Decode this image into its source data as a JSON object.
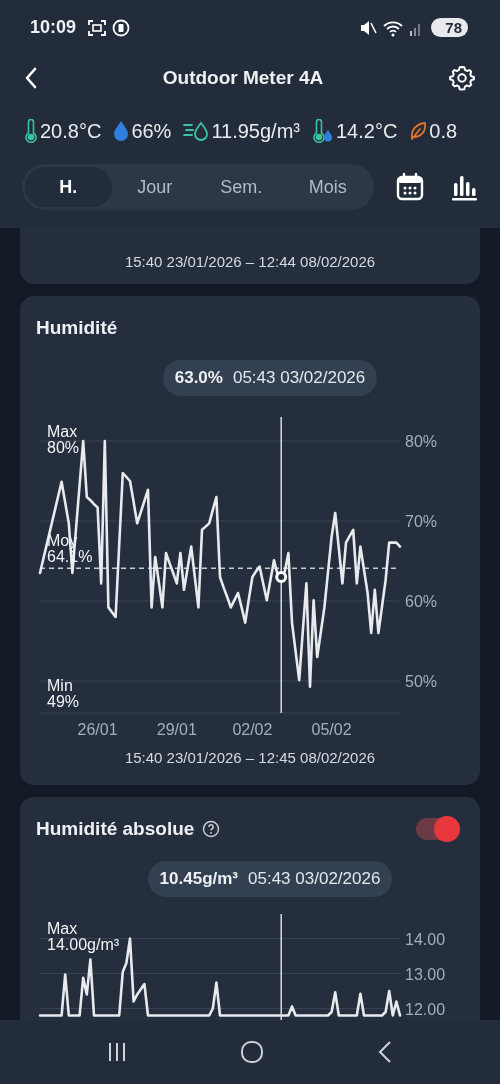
{
  "status_bar": {
    "time": "10:09",
    "battery": "78"
  },
  "header": {
    "title": "Outdoor Meter 4A"
  },
  "readings": [
    {
      "kind": "temperature",
      "color": "#3cc4a0",
      "value": "20.8°C"
    },
    {
      "kind": "humidity",
      "color": "#2f7fe0",
      "value": "66%"
    },
    {
      "kind": "absolute_humidity",
      "color": "#3cc4a0",
      "value": "11.95g/m³"
    },
    {
      "kind": "dew_point",
      "color": "#3cc4a0",
      "value": "14.2°C"
    },
    {
      "kind": "vpd",
      "color": "#e0762f",
      "value": "0.8"
    }
  ],
  "period_tabs": [
    {
      "label": "H.",
      "selected": true
    },
    {
      "label": "Jour",
      "selected": false
    },
    {
      "label": "Sem.",
      "selected": false
    },
    {
      "label": "Mois",
      "selected": false
    }
  ],
  "cards": [
    {
      "kind": "partial",
      "range": "15:40 23/01/2026 – 12:44 08/02/2026"
    },
    {
      "kind": "chart",
      "title": "Humidité",
      "tooltip": {
        "value": "63.0%",
        "time": "05:43 03/02/2026"
      },
      "stats": [
        {
          "kind": "max",
          "label": "Max",
          "value": "80%"
        },
        {
          "kind": "avg",
          "label": "Moy",
          "value": "64.1%"
        },
        {
          "kind": "min",
          "label": "Min",
          "value": "49%"
        }
      ],
      "chart_data": {
        "type": "line",
        "grid": true,
        "ylim": [
          46,
          83
        ],
        "yticks": [
          {
            "value": 80,
            "label": "80%"
          },
          {
            "value": 70,
            "label": "70%"
          },
          {
            "value": 60,
            "label": "60%"
          },
          {
            "value": 50,
            "label": "50%"
          }
        ],
        "categories": [
          null,
          null,
          null,
          null,
          null,
          null,
          null,
          null,
          null,
          null,
          null,
          null,
          null,
          null,
          null,
          null,
          "26/01",
          null,
          null,
          null,
          null,
          null,
          null,
          null,
          null,
          null,
          null,
          null,
          null,
          null,
          null,
          null,
          null,
          null,
          null,
          null,
          null,
          null,
          "29/01",
          null,
          null,
          null,
          null,
          null,
          null,
          null,
          null,
          null,
          null,
          null,
          null,
          null,
          null,
          null,
          null,
          null,
          null,
          null,
          null,
          "02/02",
          null,
          null,
          null,
          null,
          null,
          null,
          null,
          null,
          null,
          null,
          null,
          null,
          null,
          null,
          null,
          null,
          null,
          null,
          null,
          null,
          null,
          "05/02",
          null,
          null,
          null,
          null,
          null,
          null,
          null,
          null,
          null,
          null,
          null,
          null,
          null,
          null,
          null,
          null,
          null,
          null,
          null
        ],
        "series": [
          {
            "color": "#e8eaed",
            "values": [
              63.5,
              65.4,
              67.3,
              69.2,
              71.1,
              73.0,
              74.9,
              72.3,
              69.7,
              63.5,
              69.0,
              74.5,
              80,
              73,
              72.6,
              72.1,
              71.7,
              62.2,
              80,
              59.2,
              58.6,
              58,
              67,
              76,
              75.5,
              75,
              72.4,
              69.7,
              71.1,
              72.5,
              73.9,
              59.2,
              65.5,
              62.4,
              59.2,
              66,
              64.7,
              63.5,
              62.2,
              66,
              61.4,
              64.1,
              66.8,
              63,
              59.2,
              68.9,
              69.3,
              69.7,
              71.4,
              73,
              63,
              61.7,
              60.5,
              59.2,
              60.1,
              61,
              59.2,
              57.3,
              60.2,
              63,
              63.7,
              64.3,
              62.2,
              60.1,
              62.6,
              65.1,
              63.3,
              63.0,
              63.7,
              66,
              57.3,
              53.7,
              50.1,
              56.2,
              62.2,
              49.3,
              60.1,
              53,
              56.1,
              59.2,
              63.6,
              68,
              71,
              66.6,
              62.2,
              67.3,
              68.1,
              68.9,
              62.2,
              66.8,
              63.9,
              61,
              56,
              61.4,
              56,
              59.3,
              62.6,
              67.3,
              67.3,
              67.3,
              66.8
            ]
          }
        ],
        "ref_lines": [
          {
            "axis": "y",
            "value": 64.1
          }
        ]
      },
      "range": "15:40 23/01/2026 – 12:45 08/02/2026"
    },
    {
      "kind": "chart",
      "title": "Humidité absolue",
      "help": true,
      "toggle": {
        "on": true
      },
      "tooltip": {
        "value": "10.45g/m³",
        "time": "05:43 03/02/2026"
      },
      "stats": [
        {
          "kind": "max",
          "label": "Max",
          "value": "14.00g/m³"
        }
      ],
      "chart_data": {
        "type": "line",
        "grid": true,
        "ylim": [
          11,
          14.7
        ],
        "yticks": [
          {
            "value": 14,
            "label": "14.00"
          },
          {
            "value": 13,
            "label": "13.00"
          },
          {
            "value": 12,
            "label": "12.00"
          }
        ],
        "categories": [
          null,
          null,
          null,
          null,
          null,
          null,
          null,
          null,
          null,
          null,
          null,
          null,
          null,
          null,
          null,
          null,
          null,
          null,
          null,
          null,
          null,
          null,
          null,
          null,
          null,
          null,
          null,
          null,
          null,
          null,
          null,
          null,
          null,
          null,
          null,
          null,
          null,
          null,
          null,
          null,
          null,
          null,
          null,
          null,
          null,
          null,
          null,
          null,
          null,
          null,
          null,
          null,
          null,
          null,
          null,
          null,
          null,
          null,
          null,
          null,
          null,
          null,
          null,
          null,
          null,
          null,
          null,
          null,
          null,
          null,
          null,
          null,
          null,
          null,
          null,
          null,
          null,
          null,
          null,
          null,
          null,
          null,
          null,
          null,
          null,
          null,
          null,
          null,
          null,
          null,
          null,
          null,
          null,
          null,
          null,
          null,
          null,
          null,
          null,
          null,
          null
        ],
        "series": [
          {
            "color": "#e8eaed",
            "values": [
              11.8,
              11.8,
              11.8,
              11.8,
              11.8,
              11.8,
              11.8,
              12.97,
              11.8,
              11.8,
              11.8,
              11.8,
              12.88,
              12.4,
              13.4,
              11.8,
              11.8,
              11.8,
              11.8,
              11.8,
              11.8,
              11.8,
              11.8,
              13.05,
              13.3,
              14.0,
              12.2,
              12.4,
              12.55,
              12.7,
              11.8,
              11.8,
              11.8,
              11.8,
              11.8,
              11.8,
              11.8,
              11.8,
              11.8,
              11.8,
              11.8,
              11.8,
              11.8,
              11.8,
              11.8,
              11.8,
              11.8,
              11.8,
              12.0,
              12.74,
              11.8,
              11.8,
              11.8,
              11.8,
              11.8,
              11.8,
              11.8,
              11.8,
              11.8,
              11.8,
              11.8,
              11.8,
              11.8,
              11.8,
              11.8,
              11.8,
              11.8,
              11.8,
              11.8,
              11.8,
              12.06,
              11.8,
              11.8,
              11.8,
              11.8,
              11.8,
              11.8,
              11.8,
              11.8,
              11.8,
              11.8,
              11.9,
              12.46,
              11.8,
              11.8,
              11.8,
              11.8,
              11.8,
              11.8,
              12.42,
              11.8,
              11.8,
              11.8,
              11.8,
              11.8,
              11.8,
              11.9,
              12.5,
              11.8,
              12.2,
              11.8
            ]
          }
        ]
      }
    }
  ]
}
